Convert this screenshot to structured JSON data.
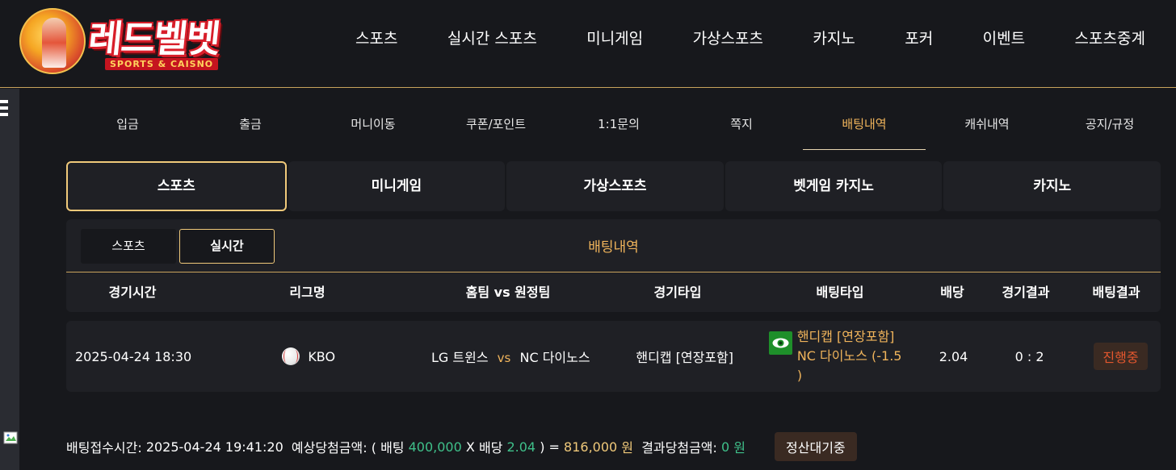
{
  "brand": {
    "title": "레드벨벳",
    "subtitle": "SPORTS & CAISNO"
  },
  "topnav": [
    {
      "label": "스포츠"
    },
    {
      "label": "실시간 스포츠"
    },
    {
      "label": "미니게임"
    },
    {
      "label": "가상스포츠"
    },
    {
      "label": "카지노"
    },
    {
      "label": "포커"
    },
    {
      "label": "이벤트"
    },
    {
      "label": "스포츠중계"
    }
  ],
  "subnav": [
    {
      "label": "입금"
    },
    {
      "label": "출금"
    },
    {
      "label": "머니이동"
    },
    {
      "label": "쿠폰/포인트"
    },
    {
      "label": "1:1문의"
    },
    {
      "label": "쪽지"
    },
    {
      "label": "배팅내역",
      "active": true
    },
    {
      "label": "캐쉬내역"
    },
    {
      "label": "공지/규정"
    }
  ],
  "category_tabs": [
    {
      "label": "스포츠",
      "active": true
    },
    {
      "label": "미니게임"
    },
    {
      "label": "가상스포츠"
    },
    {
      "label": "벳게임 카지노"
    },
    {
      "label": "카지노"
    }
  ],
  "sub_tabs": [
    {
      "label": "스포츠"
    },
    {
      "label": "실시간",
      "active": true
    }
  ],
  "panel_title": "배팅내역",
  "table": {
    "headers": [
      "경기시간",
      "리그명",
      "홈팀 vs 원정팀",
      "경기타입",
      "배팅타입",
      "배당",
      "경기결과",
      "배팅결과"
    ],
    "rows": [
      {
        "time": "2025-04-24 18:30",
        "league": "KBO",
        "home": "LG 트윈스",
        "vs": "vs",
        "away": "NC 다이노스",
        "game_type": "핸디캡 [연장포함]",
        "bet_type_line1": "핸디캡 [연장포함]",
        "bet_type_line2": "NC 다이노스 (-1.5",
        "bet_type_line3": ")",
        "odds": "2.04",
        "score": "0 : 2",
        "status": "진행중"
      }
    ]
  },
  "summary": {
    "accept_label": "배팅접수시간:",
    "accept_time": "2025-04-24 19:41:20",
    "expected_label": "예상당첨금액: (",
    "bet_label": "배팅",
    "bet_amount": "400,000",
    "x": "X",
    "odds_label": "배당",
    "odds_value": "2.04",
    "close_eq": ") =",
    "expected_amount": "816,000",
    "won": "원",
    "result_label": "결과당첨금액:",
    "result_amount": "0",
    "result_won": "원",
    "status_badge": "정산대기중"
  },
  "colors": {
    "background": "#17181c",
    "panel": "#1f2025",
    "accent_gold": "#f0b45b",
    "accent_green": "#3fc08a",
    "status_red": "#e4572e"
  },
  "icons": [
    "menu-icon",
    "baseball-icon",
    "eye-icon",
    "broken-image-icon"
  ]
}
